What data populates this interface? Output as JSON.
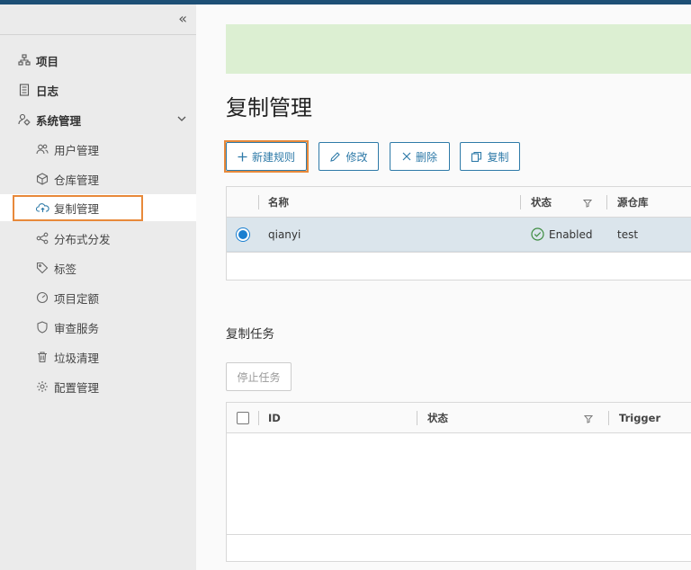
{
  "sidebar": {
    "items": [
      {
        "label": "项目"
      },
      {
        "label": "日志"
      },
      {
        "label": "系统管理"
      },
      {
        "label": "用户管理"
      },
      {
        "label": "仓库管理"
      },
      {
        "label": "复制管理"
      },
      {
        "label": "分布式分发"
      },
      {
        "label": "标签"
      },
      {
        "label": "项目定额"
      },
      {
        "label": "审查服务"
      },
      {
        "label": "垃圾清理"
      },
      {
        "label": "配置管理"
      }
    ]
  },
  "main": {
    "title": "复制管理",
    "toolbar": {
      "new_label": "新建规则",
      "edit_label": "修改",
      "delete_label": "删除",
      "copy_label": "复制"
    },
    "rules_table": {
      "columns": [
        "名称",
        "状态",
        "源仓库"
      ],
      "rows": [
        {
          "name": "qianyi",
          "status": "Enabled",
          "source": "test"
        }
      ]
    },
    "tasks_section": {
      "title": "复制任务",
      "stop_label": "停止任务",
      "columns": [
        "ID",
        "状态",
        "Trigger"
      ]
    }
  },
  "colors": {
    "topbar": "#1d4f75",
    "accent": "#2e7aa8",
    "highlight": "#e8893a",
    "banner": "#dcefd2",
    "selected_row": "#dbe5ec"
  }
}
